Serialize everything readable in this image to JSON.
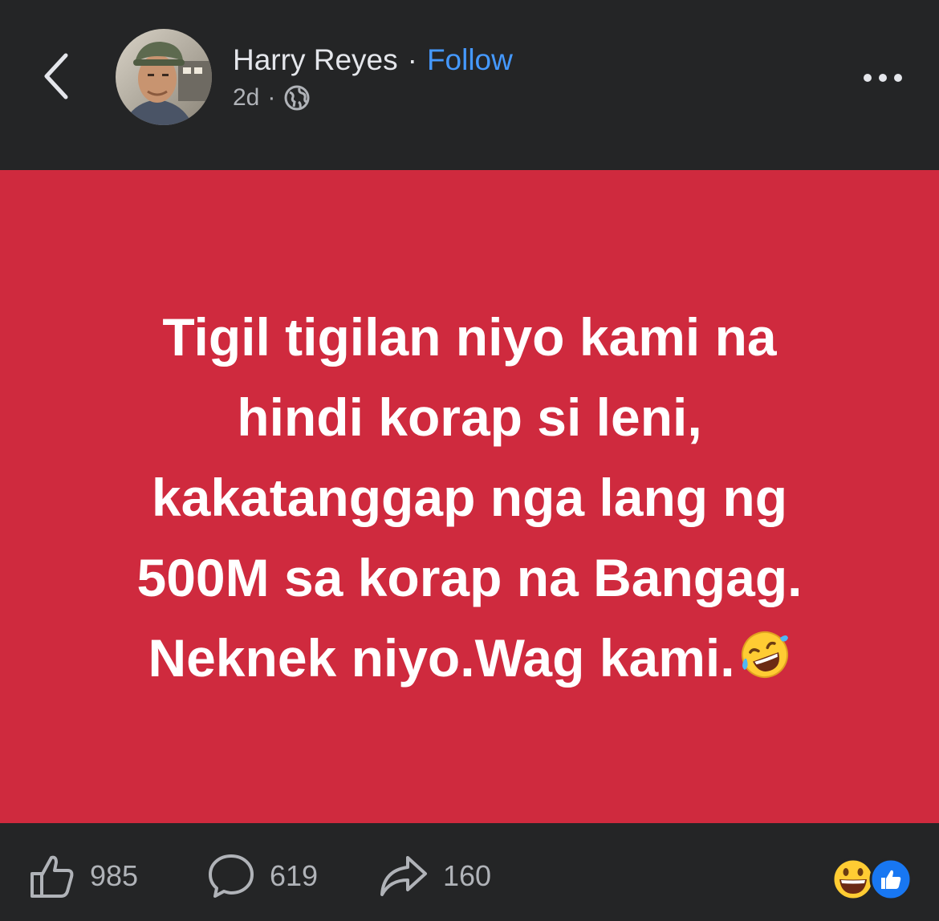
{
  "header": {
    "back_icon": "chevron-left-icon",
    "author_name": "Harry Reyes",
    "separator": "·",
    "follow_label": "Follow",
    "timestamp": "2d",
    "meta_separator": "·",
    "privacy_icon": "globe-icon",
    "more_icon": "more-horizontal-icon"
  },
  "post": {
    "background_color": "#cf2a3e",
    "lines": [
      "Tigil tigilan niyo kami na",
      "hindi korap si leni,",
      "kakatanggap nga lang ng",
      "500M sa korap na Bangag.",
      "Neknek niyo.Wag kami."
    ],
    "trailing_emoji": "rolling-on-floor-laughing-emoji"
  },
  "footer": {
    "like_count": "985",
    "comment_count": "619",
    "share_count": "160",
    "reactions": [
      "grinning-emoji",
      "like-reaction-icon"
    ],
    "accent_color": "#1877f2"
  }
}
